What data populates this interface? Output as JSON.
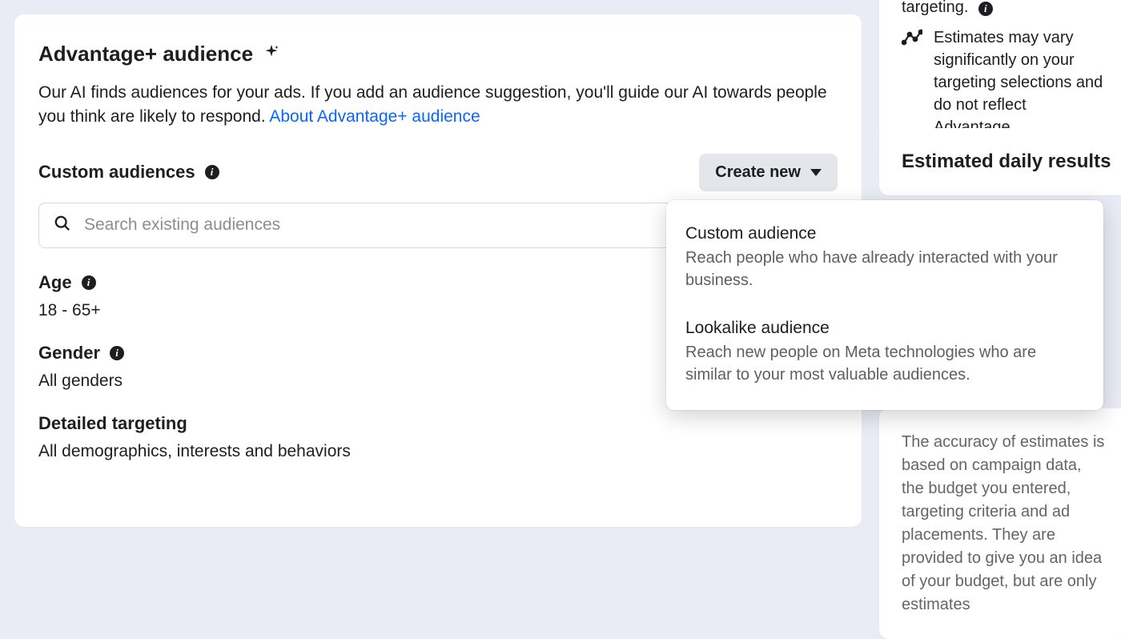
{
  "main": {
    "title": "Advantage+ audience",
    "description_part1": "Our AI finds audiences for your ads. If you add an audience suggestion, you'll guide our AI towards people you think are likely to respond. ",
    "description_link": "About Advantage+ audience",
    "custom_audiences": {
      "label": "Custom audiences",
      "create_button": "Create new",
      "search_placeholder": "Search existing audiences"
    },
    "age": {
      "label": "Age",
      "value": "18 - 65+"
    },
    "gender": {
      "label": "Gender",
      "value": "All genders"
    },
    "detailed_targeting": {
      "label": "Detailed targeting",
      "value": "All demographics, interests and behaviors"
    }
  },
  "dropdown": {
    "items": [
      {
        "title": "Custom audience",
        "description": "Reach people who have already interacted with your business."
      },
      {
        "title": "Lookalike audience",
        "description": "Reach new people on Meta technologies who are similar to your most valuable audiences."
      }
    ]
  },
  "side": {
    "top_fragment": "targeting.",
    "estimate_text": "Estimates may vary significantly on your targeting selections and do not reflect Advantage",
    "daily_results_title": "Estimated daily results",
    "accuracy_text": "The accuracy of estimates is based on campaign data, the budget you entered, targeting criteria and ad placements. They are provided to give you an idea of your budget, but are only estimates"
  }
}
